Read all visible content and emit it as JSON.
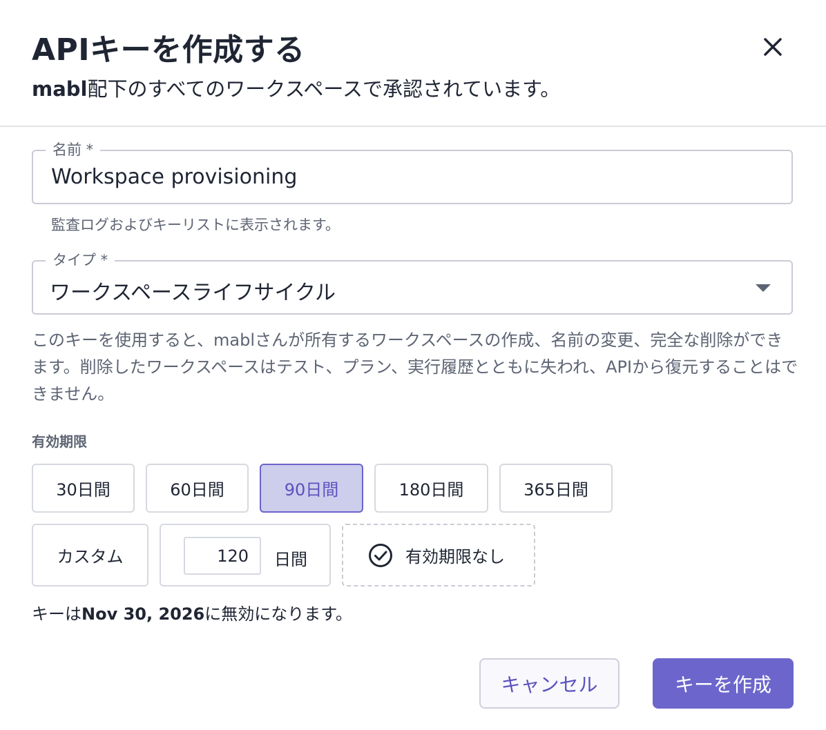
{
  "dialog": {
    "title": "APIキーを作成する",
    "subtitle_bold": "mabl",
    "subtitle_rest": "配下のすべてのワークスペースで承認されています。",
    "close_icon": "close-icon"
  },
  "name_field": {
    "label": "名前 *",
    "value": "Workspace provisioning",
    "helper": "監査ログおよびキーリストに表示されます。"
  },
  "type_field": {
    "label": "タイプ *",
    "selected": "ワークスペースライフサイクル",
    "dropdown_icon": "caret-down-icon",
    "description": "このキーを使用すると、mablさんが所有するワークスペースの作成、名前の変更、完全な削除ができます。削除したワークスペースはテスト、プラン、実行履歴とともに失われ、APIから復元することはできません。"
  },
  "expiration": {
    "label": "有効期限",
    "options": [
      "30日間",
      "60日間",
      "90日間",
      "180日間",
      "365日間"
    ],
    "selected_option": "90日間",
    "custom_label": "カスタム",
    "custom_days_value": "120",
    "custom_days_unit": "日間",
    "no_expiration_label": "有効期限なし",
    "no_expiration_icon": "check-circle-icon",
    "note_prefix": "キーは",
    "note_date": "Nov 30, 2026",
    "note_suffix": "に無効になります。"
  },
  "actions": {
    "cancel_label": "キャンセル",
    "create_label": "キーを作成"
  },
  "colors": {
    "accent": "#6c66cc",
    "selected_chip_bg": "#cdcdec",
    "text": "#1f2533",
    "muted_text": "#5d6473",
    "border": "#c9ccd4"
  }
}
